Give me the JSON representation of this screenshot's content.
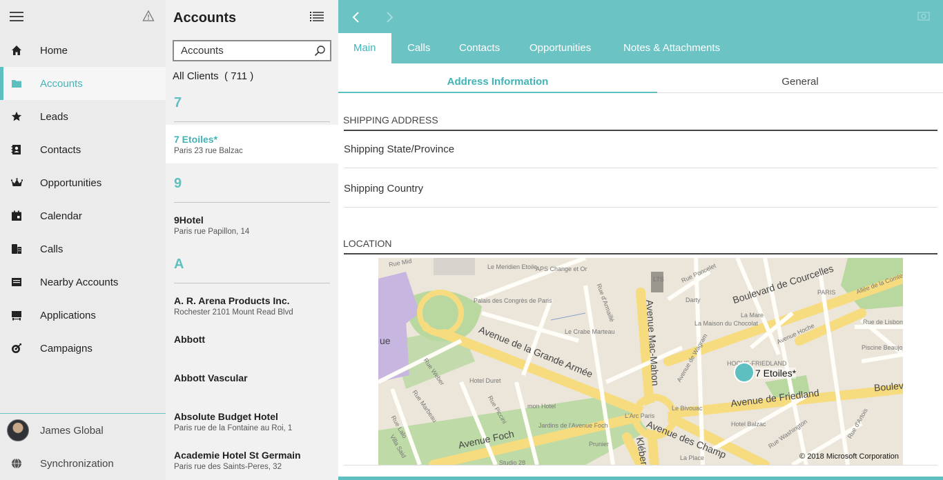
{
  "nav": {
    "items": [
      {
        "label": "Home",
        "icon": "home-icon"
      },
      {
        "label": "Accounts",
        "icon": "accounts-icon"
      },
      {
        "label": "Leads",
        "icon": "star-icon"
      },
      {
        "label": "Contacts",
        "icon": "contacts-icon"
      },
      {
        "label": "Opportunities",
        "icon": "crown-icon"
      },
      {
        "label": "Calendar",
        "icon": "calendar-icon"
      },
      {
        "label": "Calls",
        "icon": "calls-icon"
      },
      {
        "label": "Nearby Accounts",
        "icon": "nearby-icon"
      },
      {
        "label": "Applications",
        "icon": "applications-icon"
      },
      {
        "label": "Campaigns",
        "icon": "campaigns-icon"
      }
    ],
    "active": "Accounts",
    "user": "James Global",
    "sync": "Synchronization"
  },
  "list": {
    "title": "Accounts",
    "search_value": "Accounts",
    "all_clients": "All Clients",
    "count": "( 711 )",
    "groups": [
      "7",
      "9",
      "A"
    ],
    "accounts": [
      {
        "name": "7 Etoiles*",
        "address": "Paris 23 rue Balzac"
      },
      {
        "name": "9Hotel",
        "address": "Paris rue Papillon, 14"
      },
      {
        "name": "A. R. Arena Products Inc.",
        "address": "Rochester 2101 Mount Read Blvd"
      },
      {
        "name": "Abbott",
        "address": ""
      },
      {
        "name": "Abbott Vascular",
        "address": ""
      },
      {
        "name": "Absolute Budget Hotel",
        "address": "Paris rue de la Fontaine au Roi, 1"
      },
      {
        "name": "Academie Hotel St Germain",
        "address": "Paris rue des Saints-Peres, 32"
      }
    ]
  },
  "detail": {
    "tabs": [
      "Main",
      "Calls",
      "Contacts",
      "Opportunities",
      "Notes & Attachments"
    ],
    "active_tab": "Main",
    "subtabs": [
      "Address Information",
      "General"
    ],
    "sections": {
      "shipping": "SHIPPING ADDRESS",
      "location": "LOCATION"
    },
    "fields": [
      "Shipping State/Province",
      "Shipping Country"
    ],
    "map": {
      "pin_label": "7 Etoiles*",
      "copyright": "© 2018 Microsoft Corporation",
      "roads": [
        "Avenue de la Grande Armée",
        "Avenue Mac-Mahon",
        "Boulevard de Courcelles",
        "Avenue de Friedland",
        "Avenue Foch",
        "Avenue des Champ",
        "Boulevar",
        "Kléber",
        "ue"
      ],
      "labels": [
        "Le Meridien Etoile",
        "APS Change et Or",
        "Palais des Congrès de Paris",
        "Rue d'Armaillé",
        "Le Crabe Marteau",
        "Rue Poncelet",
        "Darty",
        "La Maison du Chocolat",
        "La Mare",
        "PARIS",
        "Allée de la Comtesse",
        "Rue de Lisbonne",
        "Avenue Hoche",
        "Piscine Beaujon",
        "HOCHE-FRIEDLAND",
        "Avenue de Wagram",
        "Hotel Duret",
        "Rue Weber",
        "Rue Marbeau",
        "Rue Lalo",
        "Villa Said",
        "Rue Piccini",
        "mon Hotel",
        "Jardins de l'Avenue Foch",
        "L'Arc Paris",
        "Le Bivouac",
        "Hotel Balzac",
        "Rue Washington",
        "Rue d'Artois",
        "Prunier",
        "La Place",
        "Studio 28",
        "Rue Mid",
        "LTS"
      ]
    }
  },
  "colors": {
    "accent": "#6cc3c4",
    "accent_text": "#40b4b7",
    "nav_bg": "#ebebeb",
    "list_bg": "#f1f1f1"
  }
}
